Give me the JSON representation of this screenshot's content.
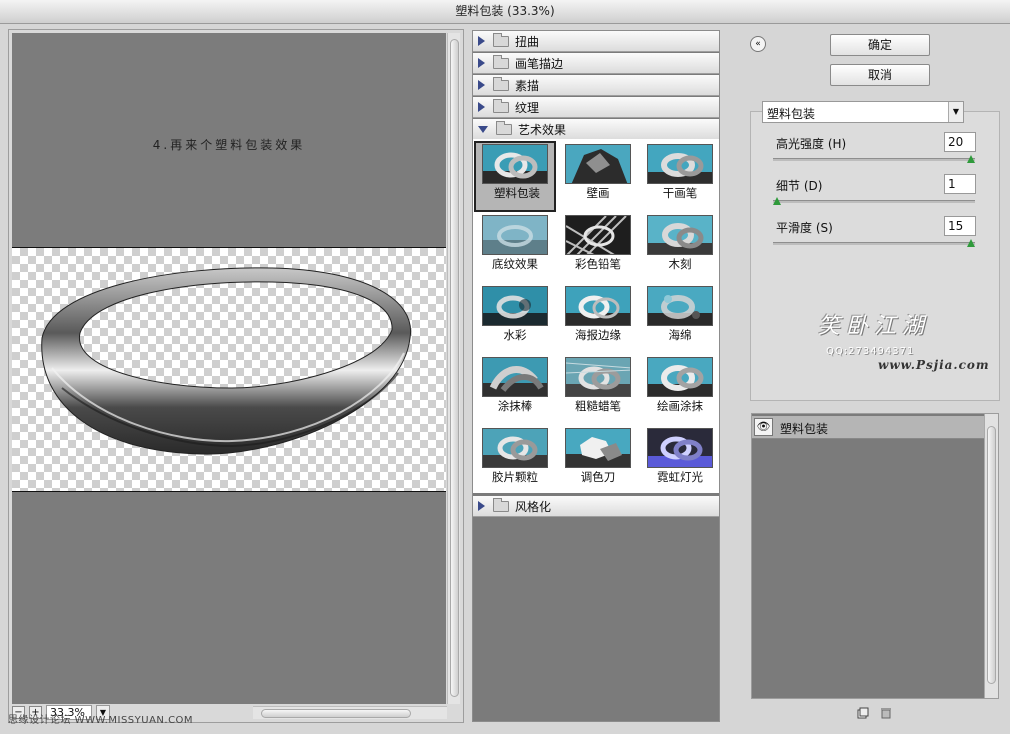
{
  "window": {
    "title": "塑料包装 (33.3%)"
  },
  "preview": {
    "caption": "4.再来个塑料包装效果",
    "zoom": "33.3%",
    "zoom_out": "−",
    "zoom_in": "+",
    "watermark": "思缘设计论坛 WWW.MISSYUAN.COM"
  },
  "filters": {
    "categories_top": [
      {
        "label": "扭曲"
      },
      {
        "label": "画笔描边"
      },
      {
        "label": "素描"
      },
      {
        "label": "纹理"
      },
      {
        "label": "艺术效果"
      }
    ],
    "category_bottom": {
      "label": "风格化"
    },
    "tiles": [
      {
        "label": "塑料包装",
        "selected": true
      },
      {
        "label": "壁画"
      },
      {
        "label": "干画笔"
      },
      {
        "label": "底纹效果"
      },
      {
        "label": "彩色铅笔"
      },
      {
        "label": "木刻"
      },
      {
        "label": "水彩"
      },
      {
        "label": "海报边缘"
      },
      {
        "label": "海绵"
      },
      {
        "label": "涂抹棒"
      },
      {
        "label": "粗糙蜡笔"
      },
      {
        "label": "绘画涂抹"
      },
      {
        "label": "胶片颗粒"
      },
      {
        "label": "调色刀"
      },
      {
        "label": "霓虹灯光"
      }
    ]
  },
  "actions": {
    "ok": "确定",
    "cancel": "取消",
    "collapse": "«"
  },
  "settings": {
    "selected_filter": "塑料包装",
    "params": [
      {
        "label": "高光强度 (H)",
        "value": "20",
        "level": 1.0
      },
      {
        "label": "细节 (D)",
        "value": "1",
        "level": 0.0
      },
      {
        "label": "平滑度 (S)",
        "value": "15",
        "level": 1.0
      }
    ]
  },
  "logo": {
    "art": "笑卧江湖",
    "qq": "QQ:273494371",
    "url": "www.Psjia.com"
  },
  "layers": {
    "items": [
      {
        "label": "塑料包装"
      }
    ]
  },
  "colors": {
    "slider_handle": "#2f9a3b",
    "panel_gray": "#7b7b7b"
  }
}
